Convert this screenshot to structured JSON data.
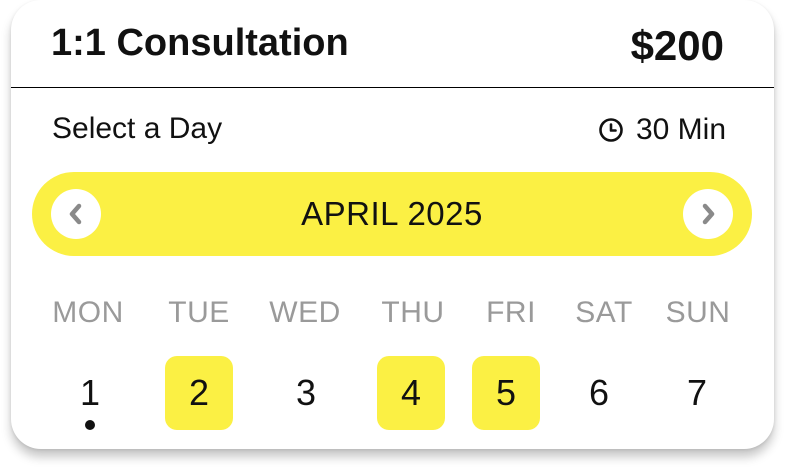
{
  "header": {
    "title": "1:1 Consultation",
    "price": "$200"
  },
  "scheduler": {
    "select_label": "Select a Day",
    "duration": "30 Min",
    "duration_icon": "clock-icon",
    "month_label": "APRIL 2025",
    "prev_icon": "chevron-left-icon",
    "next_icon": "chevron-right-icon"
  },
  "weekdays": [
    "MON",
    "TUE",
    "WED",
    "THU",
    "FRI",
    "SAT",
    "SUN"
  ],
  "days": [
    {
      "label": "1",
      "available": false,
      "today": true
    },
    {
      "label": "2",
      "available": true,
      "today": false
    },
    {
      "label": "3",
      "available": false,
      "today": false
    },
    {
      "label": "4",
      "available": true,
      "today": false
    },
    {
      "label": "5",
      "available": true,
      "today": false
    },
    {
      "label": "6",
      "available": false,
      "today": false
    },
    {
      "label": "7",
      "available": false,
      "today": false
    }
  ],
  "colors": {
    "accent": "#fbf044",
    "text": "#111111",
    "muted": "#9a9a9a",
    "nav_chevron": "#8a8a8a"
  }
}
